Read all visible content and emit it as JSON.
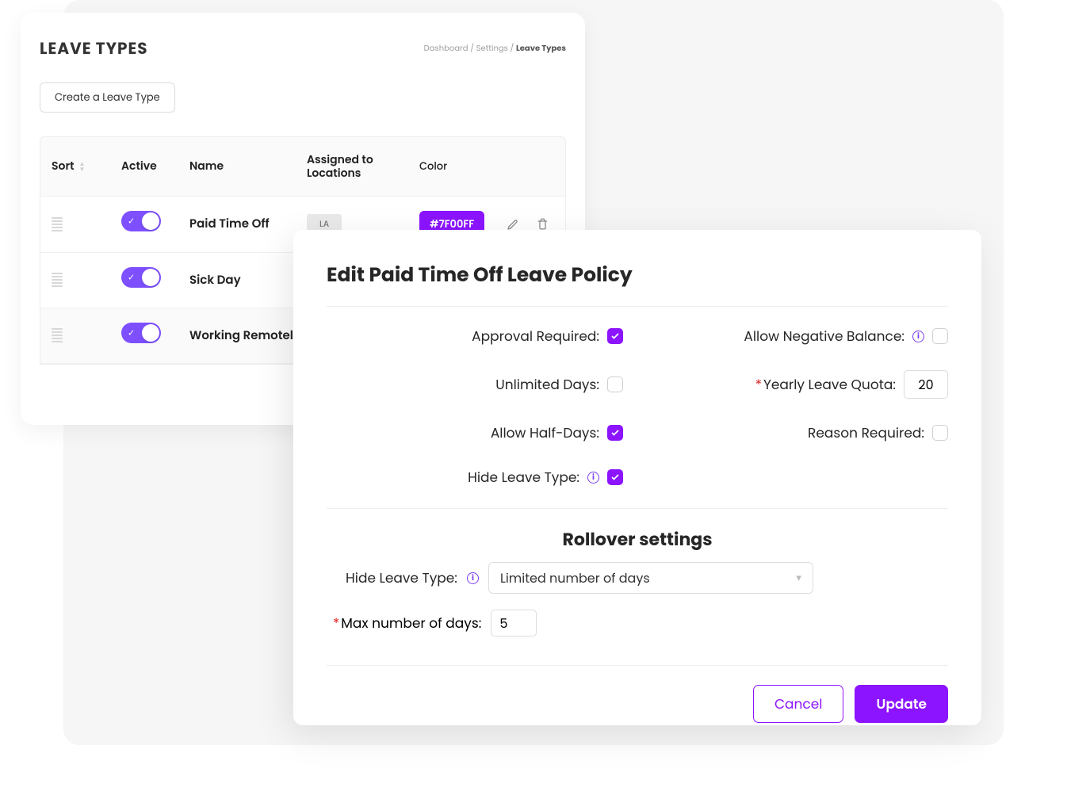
{
  "page": {
    "title": "LEAVE TYPES",
    "breadcrumb": {
      "dashboard": "Dashboard",
      "settings": "Settings",
      "current": "Leave Types",
      "sep": " / "
    },
    "create_button": "Create a Leave Type"
  },
  "table": {
    "headers": {
      "sort": "Sort",
      "active": "Active",
      "name": "Name",
      "locations": "Assigned to Locations",
      "color": "Color"
    },
    "rows": [
      {
        "name": "Paid Time Off",
        "location": "LA",
        "color": "#7F00FF",
        "active": true,
        "show_extras": true
      },
      {
        "name": "Sick Day",
        "active": true
      },
      {
        "name": "Working Remotely",
        "active": true
      }
    ]
  },
  "modal": {
    "title": "Edit Paid Time Off Leave Policy",
    "fields": {
      "approval_required": "Approval Required:",
      "unlimited_days": "Unlimited Days:",
      "allow_half_days": "Allow Half-Days:",
      "hide_leave_type": "Hide Leave Type:",
      "allow_negative": "Allow Negative Balance:",
      "yearly_quota": "Yearly Leave Quota:",
      "reason_required": "Reason Required:"
    },
    "values": {
      "approval_required": true,
      "unlimited_days": false,
      "allow_half_days": true,
      "hide_leave_type": true,
      "allow_negative": false,
      "yearly_quota": "20",
      "reason_required": false
    },
    "rollover": {
      "title": "Rollover settings",
      "hide_label": "Hide Leave Type:",
      "select_value": "Limited number of days",
      "max_label": "Max number of days:",
      "max_value": "5"
    },
    "actions": {
      "cancel": "Cancel",
      "update": "Update"
    }
  }
}
